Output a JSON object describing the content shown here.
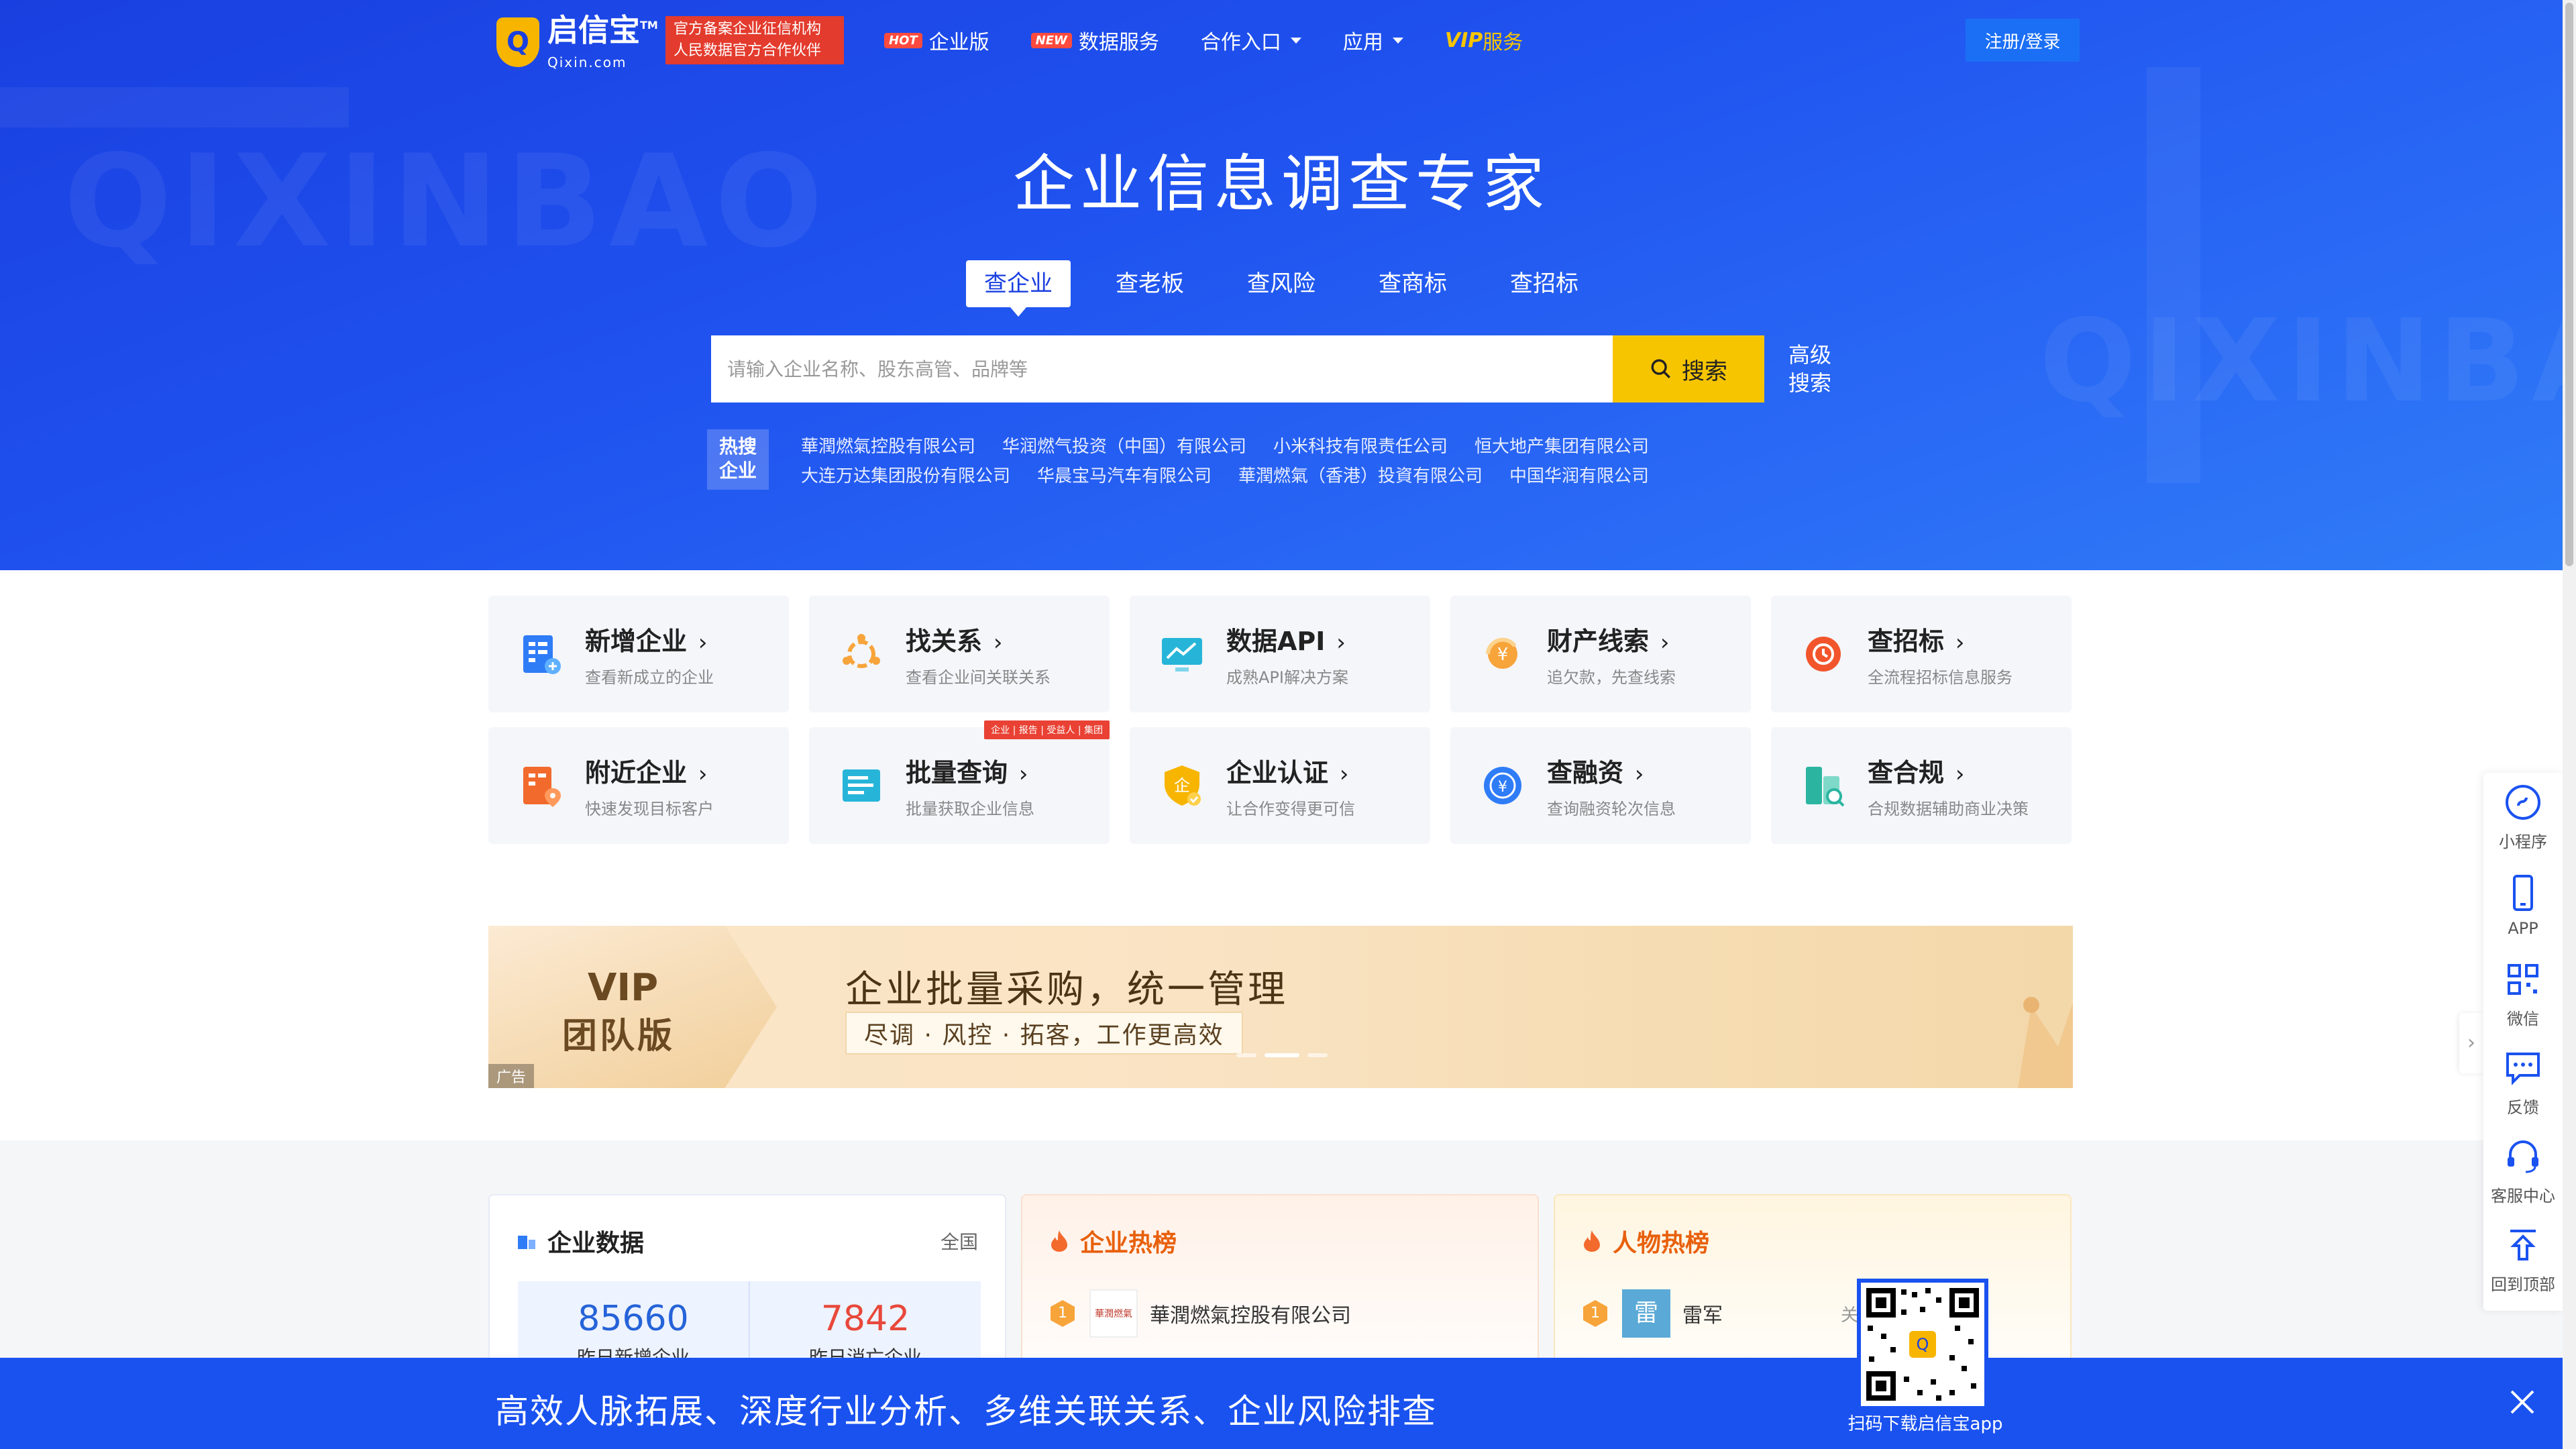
{
  "nav": {
    "logo_text": "启信宝",
    "logo_domain": "Qixin.com",
    "logo_tm": "TM",
    "badge_line1": "官方备案企业征信机构",
    "badge_line2": "人民数据官方合作伙伴",
    "items": [
      {
        "tag": "HOT",
        "label": "企业版"
      },
      {
        "tag": "NEW",
        "label": "数据服务"
      },
      {
        "label": "合作入口"
      },
      {
        "label": "应用"
      }
    ],
    "vip_prefix": "VIP",
    "vip_label": "服务",
    "login_label": "注册/登录"
  },
  "hero": {
    "watermark": "QIXINBAO",
    "title": "企业信息调查专家",
    "tabs": [
      "查企业",
      "查老板",
      "查风险",
      "查商标",
      "查招标"
    ],
    "search_placeholder": "请输入企业名称、股东高管、品牌等",
    "search_button": "搜索",
    "advanced_line1": "高级",
    "advanced_line2": "搜索",
    "hot_label_line1": "热搜",
    "hot_label_line2": "企业",
    "hot_companies": [
      "華潤燃氣控股有限公司",
      "华润燃气投资（中国）有限公司",
      "小米科技有限责任公司",
      "恒大地产集团有限公司",
      "大连万达集团股份有限公司",
      "华晨宝马汽车有限公司",
      "華潤燃氣（香港）投資有限公司",
      "中国华润有限公司"
    ]
  },
  "features": [
    {
      "title": "新增企业",
      "desc": "查看新成立的企业",
      "icon": "new-company-icon",
      "color": "#2f7cf7"
    },
    {
      "title": "找关系",
      "desc": "查看企业间关联关系",
      "icon": "relation-icon",
      "color": "#f7a43a"
    },
    {
      "title": "数据API",
      "desc": "成熟API解决方案",
      "icon": "api-icon",
      "color": "#26b5d9"
    },
    {
      "title": "财产线索",
      "desc": "追欠款，先查线索",
      "icon": "property-icon",
      "color": "#f7a43a"
    },
    {
      "title": "查招标",
      "desc": "全流程招标信息服务",
      "icon": "bidding-icon",
      "color": "#f2552c"
    },
    {
      "title": "附近企业",
      "desc": "快速发现目标客户",
      "icon": "nearby-icon",
      "color": "#f26a2c"
    },
    {
      "title": "批量查询",
      "desc": "批量获取企业信息",
      "icon": "batch-icon",
      "color": "#26b5d9",
      "ribbon": "企业 | 报告 | 受益人 | 集团"
    },
    {
      "title": "企业认证",
      "desc": "让合作变得更可信",
      "icon": "certify-icon",
      "color": "#f7b500"
    },
    {
      "title": "查融资",
      "desc": "查询融资轮次信息",
      "icon": "finance-icon",
      "color": "#2f7cf7"
    },
    {
      "title": "查合规",
      "desc": "合规数据辅助商业决策",
      "icon": "compliance-icon",
      "color": "#2bb5a0"
    }
  ],
  "ad": {
    "vip": "VIP",
    "team": "团队版",
    "title": "企业批量采购，统一管理",
    "subtitle": "尽调 · 风控 · 拓客，工作更高效",
    "tag": "广告"
  },
  "cards": {
    "data": {
      "title": "企业数据",
      "scope": "全国",
      "new_count": "85660",
      "new_label": "昨日新增企业",
      "closed_count": "7842",
      "closed_label": "昨日消亡企业"
    },
    "hot": {
      "title": "企业热榜",
      "rank": "1",
      "company": "華潤燃氣控股有限公司",
      "logo_text": "華潤燃氣"
    },
    "people": {
      "title": "人物热榜",
      "rank": "1",
      "avatar": "雷",
      "name": "雷军",
      "related": "关联企..."
    }
  },
  "app_bar": {
    "slogan": "高效人脉拓展、深度行业分析、多维关联关系、企业风险排查",
    "qr_caption": "扫码下载启信宝app"
  },
  "side_toolbar": [
    {
      "label": "小程序",
      "icon": "mini-program-icon"
    },
    {
      "label": "APP",
      "icon": "phone-icon"
    },
    {
      "label": "微信",
      "icon": "qrcode-icon"
    },
    {
      "label": "反馈",
      "icon": "feedback-icon"
    },
    {
      "label": "客服中心",
      "icon": "headset-icon"
    },
    {
      "label": "回到顶部",
      "icon": "back-to-top-icon"
    }
  ],
  "colors": {
    "brand_blue": "#1a52f0",
    "accent_yellow": "#f7c500",
    "stat_new": "#2563d8",
    "stat_closed": "#e8483a",
    "hot_orange": "#e8600c"
  }
}
